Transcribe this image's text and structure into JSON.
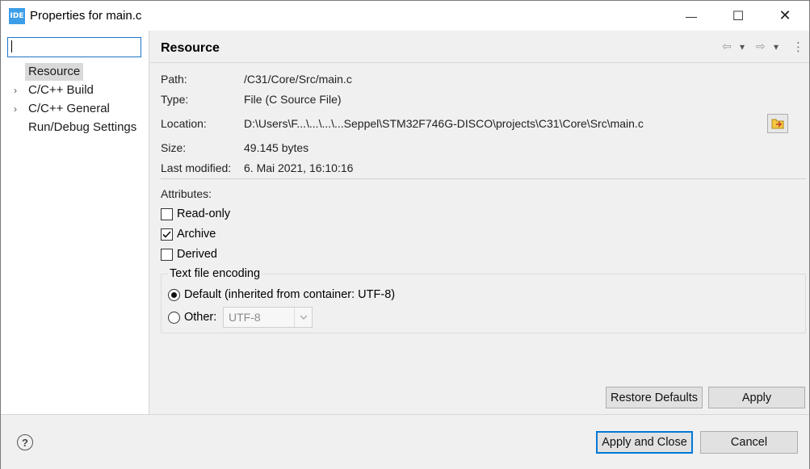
{
  "window": {
    "app_icon_text": "IDE",
    "title": "Properties for main.c",
    "minimize": "—",
    "maximize": "☐",
    "close": "✕"
  },
  "sidebar": {
    "filter_value": "",
    "items": [
      {
        "label": "Resource",
        "has_children": false,
        "selected": true
      },
      {
        "label": "C/C++ Build",
        "has_children": true,
        "selected": false
      },
      {
        "label": "C/C++ General",
        "has_children": true,
        "selected": false
      },
      {
        "label": "Run/Debug Settings",
        "has_children": false,
        "selected": false
      }
    ],
    "expand_glyph": "›"
  },
  "page": {
    "title": "Resource",
    "nav": {
      "back": "⇦",
      "back_menu": "▾",
      "forward": "⇨",
      "forward_menu": "▾",
      "more": "⋮"
    },
    "fields": {
      "path_label": "Path:",
      "path_value": "/C31/Core/Src/main.c",
      "type_label": "Type:",
      "type_value": "File  (C Source File)",
      "location_label": "Location:",
      "location_value": "D:\\Users\\F...\\...\\...\\...Seppel\\STM32F746G-DISCO\\projects\\C31\\Core\\Src\\main.c",
      "size_label": "Size:",
      "size_value": "49.145  bytes",
      "modified_label": "Last modified:",
      "modified_value": "6. Mai 2021, 16:10:16"
    },
    "attributes": {
      "label": "Attributes:",
      "read_only": {
        "label": "Read-only",
        "checked": false
      },
      "archive": {
        "label": "Archive",
        "checked": true
      },
      "derived": {
        "label": "Derived",
        "checked": false
      }
    },
    "encoding": {
      "legend": "Text file encoding",
      "default_label": "Default (inherited from container: UTF-8)",
      "other_label": "Other:",
      "other_value": "UTF-8",
      "selected": "default"
    },
    "restore_defaults": "Restore Defaults",
    "apply": "Apply"
  },
  "footer": {
    "help": "?",
    "apply_and_close": "Apply and Close",
    "cancel": "Cancel"
  }
}
